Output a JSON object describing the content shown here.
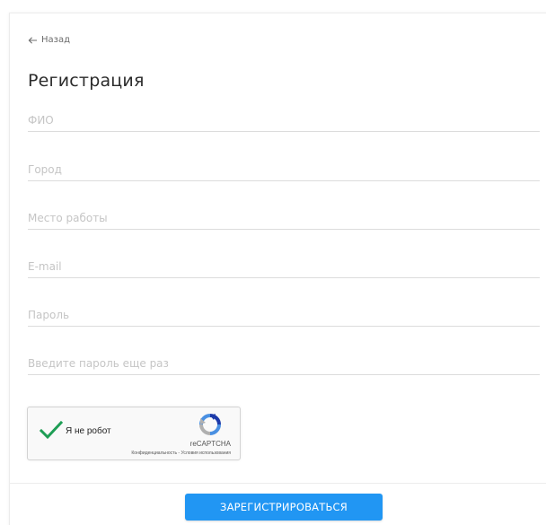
{
  "header": {
    "back_label": "Назад",
    "title": "Регистрация"
  },
  "form": {
    "fields": [
      {
        "placeholder": "ФИО",
        "value": ""
      },
      {
        "placeholder": "Город",
        "value": ""
      },
      {
        "placeholder": "Место работы",
        "value": ""
      },
      {
        "placeholder": "E-mail",
        "value": ""
      },
      {
        "placeholder": "Пароль",
        "value": ""
      },
      {
        "placeholder": "Введите пароль еще раз",
        "value": ""
      }
    ],
    "submit_label": "ЗАРЕГИСТРИРОВАТЬСЯ"
  },
  "captcha": {
    "label": "Я не робот",
    "brand": "reCAPTCHA",
    "links": "Конфиденциальность - Условия использования",
    "checked": true,
    "icons": {
      "check": "check-icon",
      "logo": "recaptcha-logo-icon"
    }
  },
  "colors": {
    "accent": "#2196f3",
    "check": "#1e9e55"
  }
}
